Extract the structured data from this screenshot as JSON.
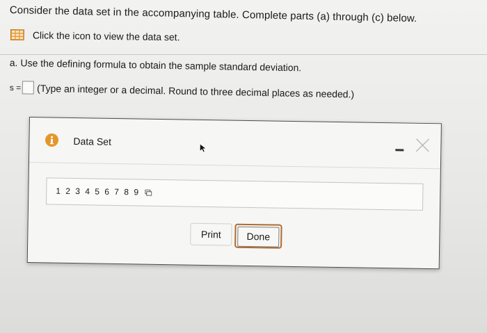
{
  "question": {
    "intro": "Consider the data set in the accompanying table. Complete parts (a) through (c) below.",
    "data_link_label": "Click the icon to view the data set.",
    "part_a": "a. Use the defining formula to obtain the sample standard deviation.",
    "answer_prefix": "s =",
    "answer_value": "",
    "answer_hint": "(Type an integer or a decimal. Round to three decimal places as needed.)"
  },
  "modal": {
    "title": "Data Set",
    "data_values": "1 2 3 4 5 6 7 8 9",
    "print_label": "Print",
    "done_label": "Done"
  },
  "icons": {
    "data_table": "grid-icon",
    "info": "info-icon",
    "minimize": "minimize-icon",
    "close": "close-icon",
    "copy": "copy-icon",
    "cursor": "pointer-cursor-icon"
  },
  "colors": {
    "grid_icon": "#e29a3c",
    "info_icon": "#e5962a",
    "done_border": "#b06a2c"
  }
}
